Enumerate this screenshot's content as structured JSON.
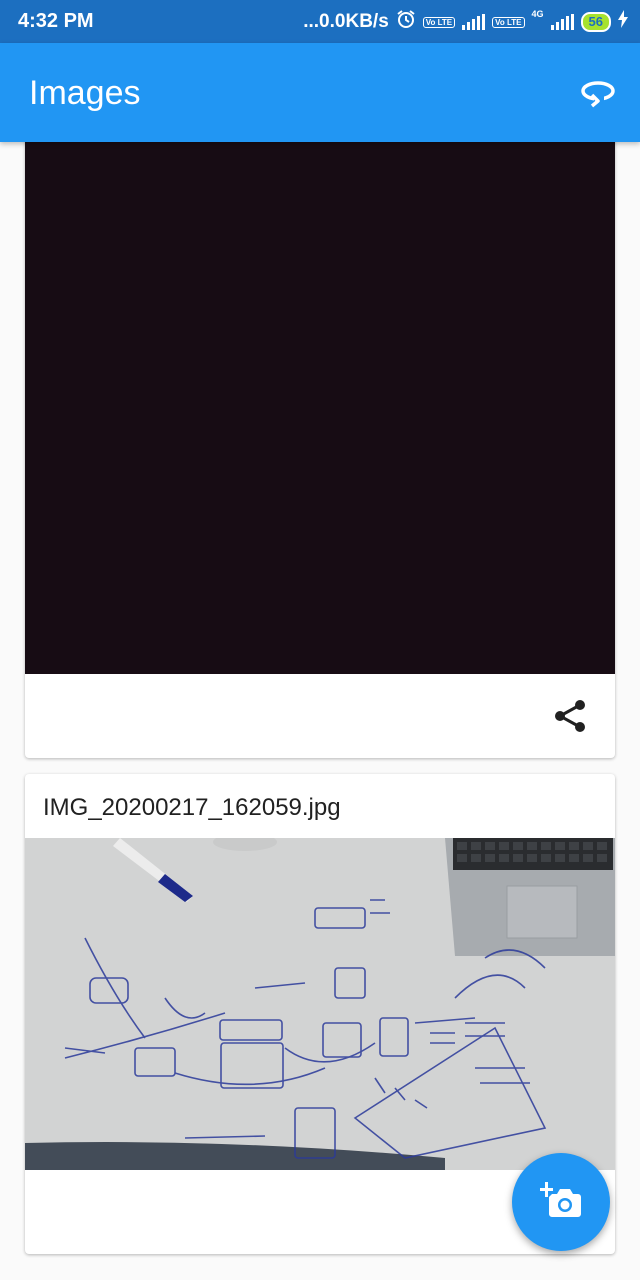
{
  "status_bar": {
    "time": "4:32 PM",
    "network_speed": "...0.0KB/s",
    "volte_label": "Vo LTE",
    "network_type": "4G",
    "battery": "56"
  },
  "app_bar": {
    "title": "Images",
    "action_icon": "rotate-icon"
  },
  "images": [
    {
      "file_name": "",
      "share_icon": "share-icon"
    },
    {
      "file_name": "IMG_20200217_162059.jpg"
    }
  ],
  "fab": {
    "icon": "add-a-photo-icon"
  },
  "colors": {
    "primary": "#2196f3",
    "status_bar": "#1c6fc0"
  }
}
